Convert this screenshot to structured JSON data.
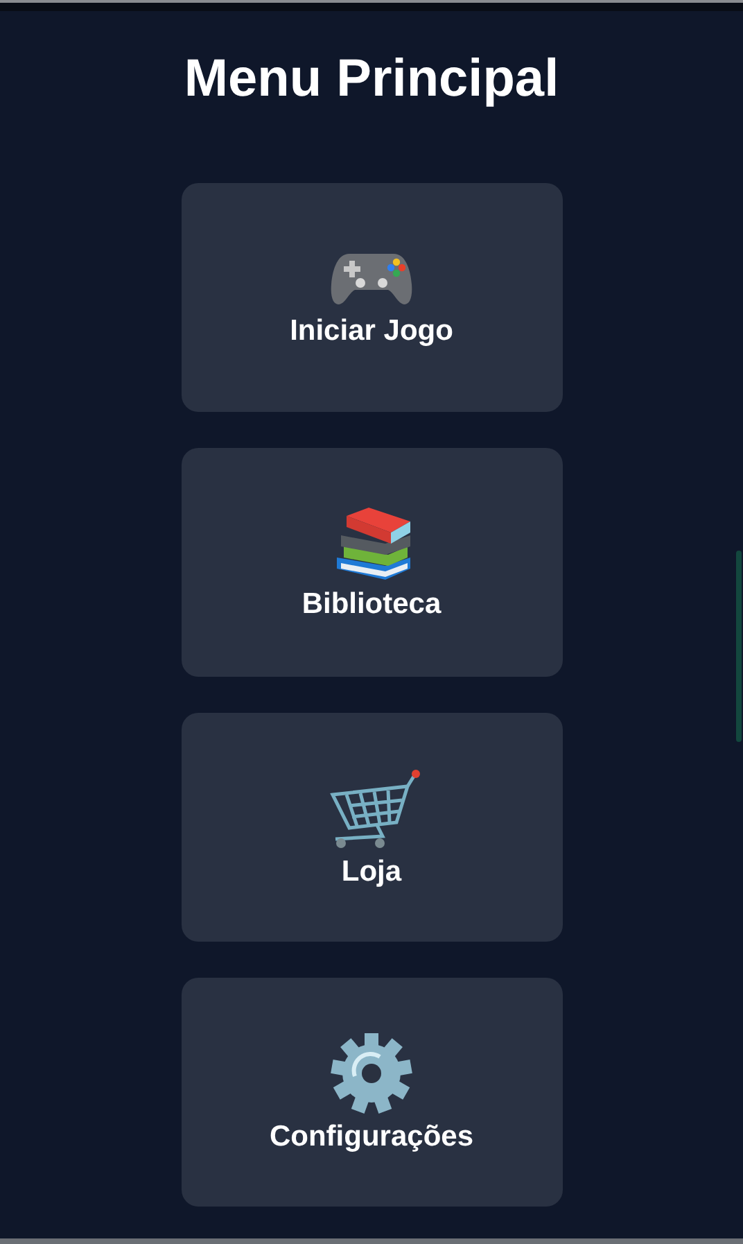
{
  "title": "Menu Principal",
  "menu_items": [
    {
      "kind": "gamepad",
      "label": "Iniciar Jogo"
    },
    {
      "kind": "books",
      "label": "Biblioteca"
    },
    {
      "kind": "cart",
      "label": "Loja"
    },
    {
      "kind": "gear",
      "label": "Configurações"
    }
  ]
}
